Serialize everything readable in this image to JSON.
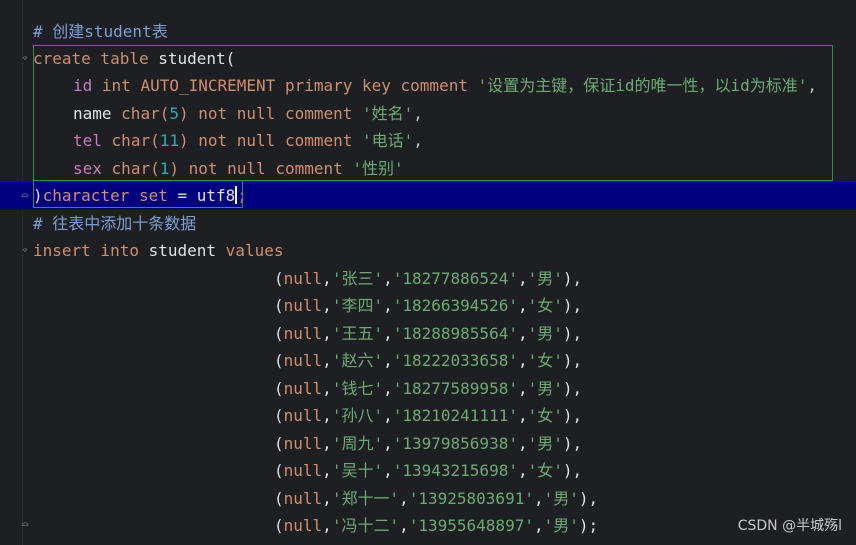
{
  "editor": {
    "comment_create": "# 创建student表",
    "create_kw": "create table",
    "create_name": " student(",
    "fields": [
      {
        "name": "id",
        "type": "int",
        "extra": " AUTO_INCREMENT primary key comment ",
        "comment": "'设置为主键，保证id的唯一性，以id为标准'",
        "tail": ","
      },
      {
        "name": "name",
        "type": "char(",
        "size": "5",
        "extra": ") not null comment ",
        "comment": "'姓名'",
        "tail": ","
      },
      {
        "name": "tel",
        "type": "char(",
        "size": "11",
        "extra": ") not null comment ",
        "comment": "'电话'",
        "tail": ","
      },
      {
        "name": "sex",
        "type": "char(",
        "size": "1",
        "extra": ") not null comment ",
        "comment": "'性别'",
        "tail": ""
      }
    ],
    "close_paren": ")",
    "charset_kw": "character set",
    "charset_eq": " = ",
    "charset_val": "utf8",
    "semicolon": ";",
    "comment_insert": "# 往表中添加十条数据",
    "insert_kw": "insert into",
    "insert_table": " student ",
    "values_kw": "values",
    "rows": [
      {
        "name": "'张三'",
        "tel": "'18277886524'",
        "sex": "'男'",
        "end": "),"
      },
      {
        "name": "'李四'",
        "tel": "'18266394526'",
        "sex": "'女'",
        "end": "),"
      },
      {
        "name": "'王五'",
        "tel": "'18288985564'",
        "sex": "'男'",
        "end": "),"
      },
      {
        "name": "'赵六'",
        "tel": "'18222033658'",
        "sex": "'女'",
        "end": "),"
      },
      {
        "name": "'钱七'",
        "tel": "'18277589958'",
        "sex": "'男'",
        "end": "),"
      },
      {
        "name": "'孙八'",
        "tel": "'18210241111'",
        "sex": "'女'",
        "end": "),"
      },
      {
        "name": "'周九'",
        "tel": "'13979856938'",
        "sex": "'男'",
        "end": "),"
      },
      {
        "name": "'吴十'",
        "tel": "'13943215698'",
        "sex": "'女'",
        "end": "),"
      },
      {
        "name": "'郑十一'",
        "tel": "'13925803691'",
        "sex": "'男'",
        "end": "),"
      },
      {
        "name": "'冯十二'",
        "tel": "'13955648897'",
        "sex": "'男'",
        "end": ");"
      }
    ],
    "null_kw": "null"
  },
  "watermark": "CSDN @半城殇l",
  "colors": {
    "background": "#1e1f22",
    "current_line": "#000080",
    "keyword": "#cf8e6d",
    "string": "#6aab73",
    "number": "#2aacb8",
    "identifier": "#c77dbb",
    "comment": "#7a9fd4",
    "selection_box": "#3b8f3b"
  }
}
